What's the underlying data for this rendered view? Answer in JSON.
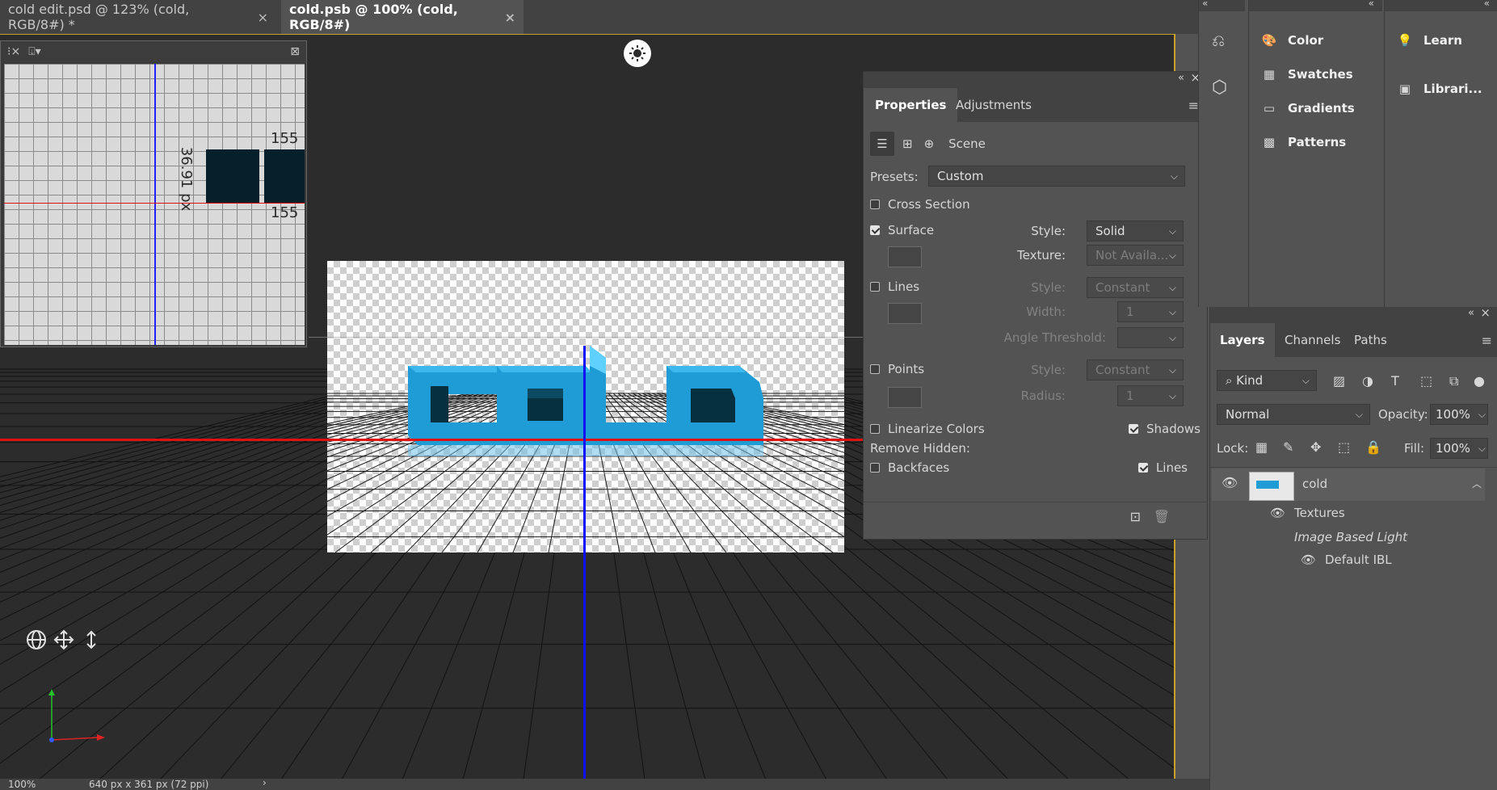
{
  "document_tabs": [
    {
      "label": "cold edit.psd @ 123% (cold, RGB/8#) *",
      "close": "×",
      "active": false
    },
    {
      "label": "cold.psb @ 100% (cold, RGB/8#)",
      "close": "×",
      "active": true
    }
  ],
  "secondary_view": {
    "dimension_top": "155",
    "dimension_bottom": "155",
    "dimension_side": "36.91 px"
  },
  "canvas_text": "COLD",
  "properties_panel": {
    "tabs": [
      "Properties",
      "Adjustments"
    ],
    "section_label": "Scene",
    "presets_label": "Presets:",
    "presets_value": "Custom",
    "cross_section": {
      "label": "Cross Section",
      "checked": false
    },
    "surface": {
      "label": "Surface",
      "checked": true,
      "style_label": "Style:",
      "style_value": "Solid",
      "texture_label": "Texture:",
      "texture_value": "Not Availa..."
    },
    "lines": {
      "label": "Lines",
      "checked": false,
      "style_label": "Style:",
      "style_value": "Constant",
      "width_label": "Width:",
      "width_value": "1",
      "angle_label": "Angle Threshold:"
    },
    "points": {
      "label": "Points",
      "checked": false,
      "style_label": "Style:",
      "style_value": "Constant",
      "radius_label": "Radius:",
      "radius_value": "1"
    },
    "linearize": {
      "label": "Linearize Colors",
      "checked": false
    },
    "shadows": {
      "label": "Shadows",
      "checked": true
    },
    "remove_hidden_label": "Remove Hidden:",
    "backfaces": {
      "label": "Backfaces",
      "checked": false
    },
    "remove_lines": {
      "label": "Lines",
      "checked": true
    }
  },
  "dock": {
    "column1": [
      "Color",
      "Swatches",
      "Gradients",
      "Patterns"
    ],
    "column2": [
      "Learn",
      "Librari..."
    ]
  },
  "layers_panel": {
    "tabs": [
      "Layers",
      "Channels",
      "Paths"
    ],
    "filter_label": "Kind",
    "blend_mode": "Normal",
    "opacity_label": "Opacity:",
    "opacity_value": "100%",
    "lock_label": "Lock:",
    "fill_label": "Fill:",
    "fill_value": "100%",
    "layers": [
      {
        "name": "cold",
        "visible": true
      },
      {
        "name": "Textures",
        "visible": true
      },
      {
        "name": "Image Based Light",
        "visible": false
      },
      {
        "name": "Default IBL",
        "visible": true
      }
    ]
  },
  "status_bar": {
    "zoom": "100%",
    "doc_info": "640 px x 361 px (72 ppi)",
    "arrow": "›"
  },
  "colors": {
    "accent_blue": "#1f9bd6",
    "guide_red": "#e01010",
    "guide_blue": "#1010ff",
    "frame_yellow": "#c9a227"
  }
}
